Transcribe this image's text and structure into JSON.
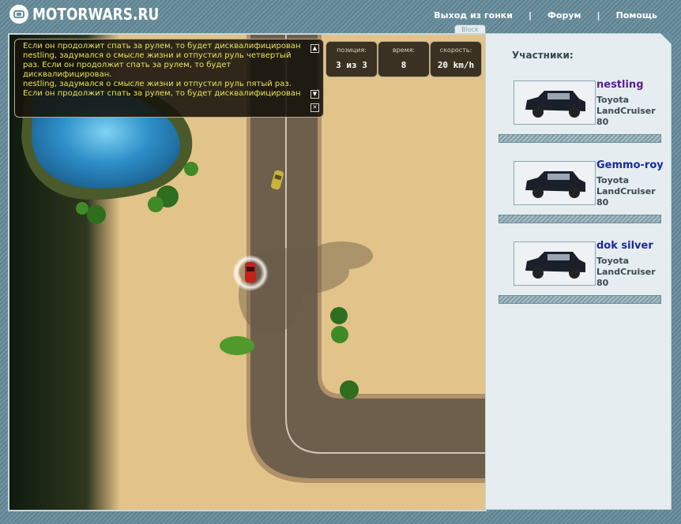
{
  "header": {
    "logo_text": "MOTORWARS.RU",
    "nav": [
      {
        "label": "Выход из гонки"
      },
      {
        "label": "Форум"
      },
      {
        "label": "Помощь"
      }
    ],
    "nav_separator": "|",
    "block_tab": "Block"
  },
  "chat": {
    "lines": [
      "Если он продолжит спать за рулем, то будет дисквалифицирован.",
      "nestling, задумался о смысле жизни и отпустил руль четвертый",
      "раз. Если он продолжит спать за рулем, то будет",
      "дисквалифицирован.",
      "nestling, задумался о смысле жизни и отпустил руль пятый раз.",
      "Если он продолжит спать за рулем, то будет дисквалифицирован."
    ],
    "scroll_up_icon": "▲",
    "scroll_down_icon": "▼",
    "close_icon": "✕"
  },
  "stats": {
    "position": {
      "label": "позиция:",
      "value": "3 из 3"
    },
    "time": {
      "label": "время:",
      "value": "8"
    },
    "speed": {
      "label": "скорость:",
      "value": "20 km/h"
    }
  },
  "participants": {
    "title": "Участники:",
    "list": [
      {
        "name": "nestling",
        "name_color": "#5a1f8c",
        "car_line1": "Toyota",
        "car_line2": "LandCruiser",
        "car_line3": "80"
      },
      {
        "name": "Gemmo-roy",
        "name_color": "#1a2a9a",
        "car_line1": "Toyota",
        "car_line2": "LandCruiser",
        "car_line3": "80"
      },
      {
        "name": "dok silver",
        "name_color": "#1a2a9a",
        "car_line1": "Toyota",
        "car_line2": "LandCruiser",
        "car_line3": "80"
      }
    ]
  },
  "colors": {
    "sand": "#e2c389",
    "road": "#6e5f4d",
    "water": "#2e8fc9",
    "player_car": "#c0241e",
    "opponent_car": "#c8b23a",
    "chat_text": "#e8e25a"
  }
}
